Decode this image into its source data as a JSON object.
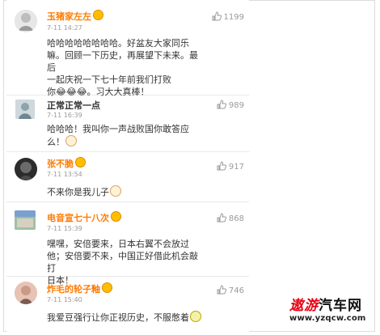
{
  "colors": {
    "name": "#ff7a00",
    "name_alt": "#1d5fb0",
    "watermark_left": "#e60012",
    "watermark_right": "#111111"
  },
  "comments": [
    {
      "user": "玉猪家左左",
      "time": "7-11 14:27",
      "likes": "1199",
      "text_lines": [
        "哈哈哈哈哈哈哈哈。好盆友大家同乐",
        "嘛。回顾一下历史，再展望下未来。最后",
        "一起庆祝一下七十年前我们打败",
        "你😂😂😂。习大大真棒！"
      ]
    },
    {
      "user": "正常正常一点",
      "time": "7-11 16:39",
      "likes": "989",
      "text_lines": [
        "哈哈哈！我叫你一声战败国你敢答应",
        "么！"
      ]
    },
    {
      "user": "张不脆",
      "time": "7-11 13:54",
      "likes": "917",
      "text_lines": [
        "不来你是我儿子"
      ]
    },
    {
      "user": "电音宣七十八次",
      "time": "7-11 15:39",
      "likes": "868",
      "text_lines": [
        "嘿嘿，安倍要来，日本右翼不会放过",
        "他；安倍要不来，中国正好借此机会敲打",
        "日本！"
      ]
    },
    {
      "user": "炸毛的轮子釉",
      "time": "7-11 15:40",
      "likes": "746",
      "text_lines": [
        "我爱豆强行让你正视历史，不服憋着"
      ]
    }
  ],
  "watermark": {
    "left": "遨游",
    "right": "汽车网",
    "url": "www.yzqcw.com"
  }
}
